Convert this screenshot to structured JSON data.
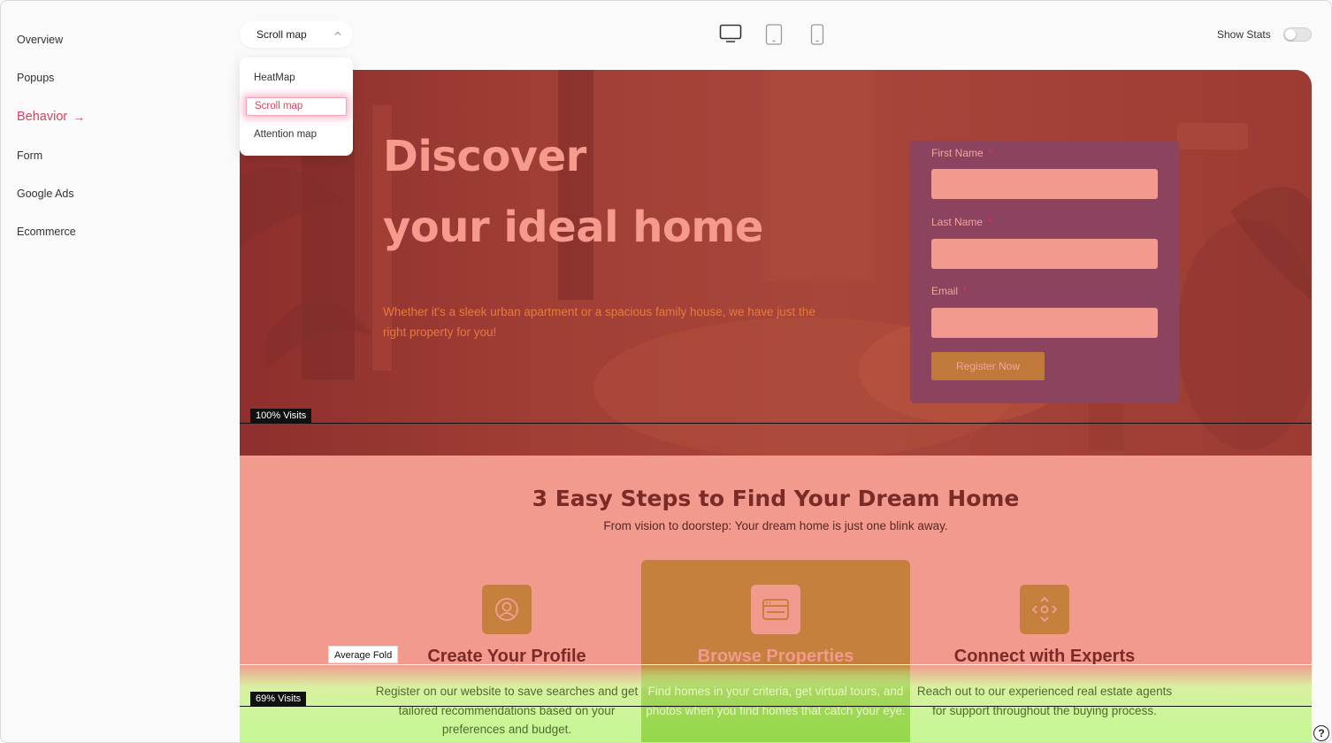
{
  "sidebar": {
    "items": [
      {
        "label": "Overview"
      },
      {
        "label": "Popups"
      },
      {
        "label": "Behavior",
        "active": true
      },
      {
        "label": "Form"
      },
      {
        "label": "Google Ads"
      },
      {
        "label": "Ecommerce"
      }
    ],
    "active_arrow": "→"
  },
  "toolbar": {
    "mode_label": "Scroll map",
    "devices": [
      "desktop-icon",
      "tablet-icon",
      "mobile-icon"
    ],
    "show_stats_label": "Show Stats",
    "show_stats_on": false
  },
  "dropdown": {
    "options": [
      "HeatMap",
      "Scroll map",
      "Attention map"
    ],
    "selected": "Scroll map"
  },
  "hero": {
    "title_line1": "Discover",
    "title_line2": "your ideal home",
    "subtitle": "Whether it's a sleek urban apartment or a spacious family house, we have just the right property for you!"
  },
  "form": {
    "first_name_label": "First Name",
    "last_name_label": "Last Name",
    "email_label": "Email",
    "required_mark": "*",
    "first_name_value": "",
    "last_name_value": "",
    "email_value": "",
    "submit_label": "Register Now"
  },
  "scrollmap": {
    "visits_100": "100% Visits",
    "visits_69": "69% Visits",
    "average_fold": "Average Fold"
  },
  "steps": {
    "title": "3 Easy Steps to Find Your Dream Home",
    "subtitle": "From vision to doorstep: Your dream home is just one blink away.",
    "items": [
      {
        "title": "Create Your Profile",
        "desc": "Register on our website to save searches and get tailored recommendations based on your preferences and budget.",
        "icon": "user-circle-icon"
      },
      {
        "title": "Browse Properties",
        "desc": "Find homes in your criteria, get virtual tours, and photos when you find homes that catch your eye.",
        "icon": "browser-window-icon"
      },
      {
        "title": "Connect with Experts",
        "desc": "Reach out to our experienced real estate agents for support throughout the buying process.",
        "icon": "move-arrows-icon"
      }
    ]
  },
  "help": {
    "label": "?"
  },
  "colors": {
    "accent": "#d9435f",
    "hero_overlay": "#9c3b33",
    "form_card": "#8b435f",
    "steps_bg": "#f39a8f",
    "green_scroll": "#c6f793"
  }
}
